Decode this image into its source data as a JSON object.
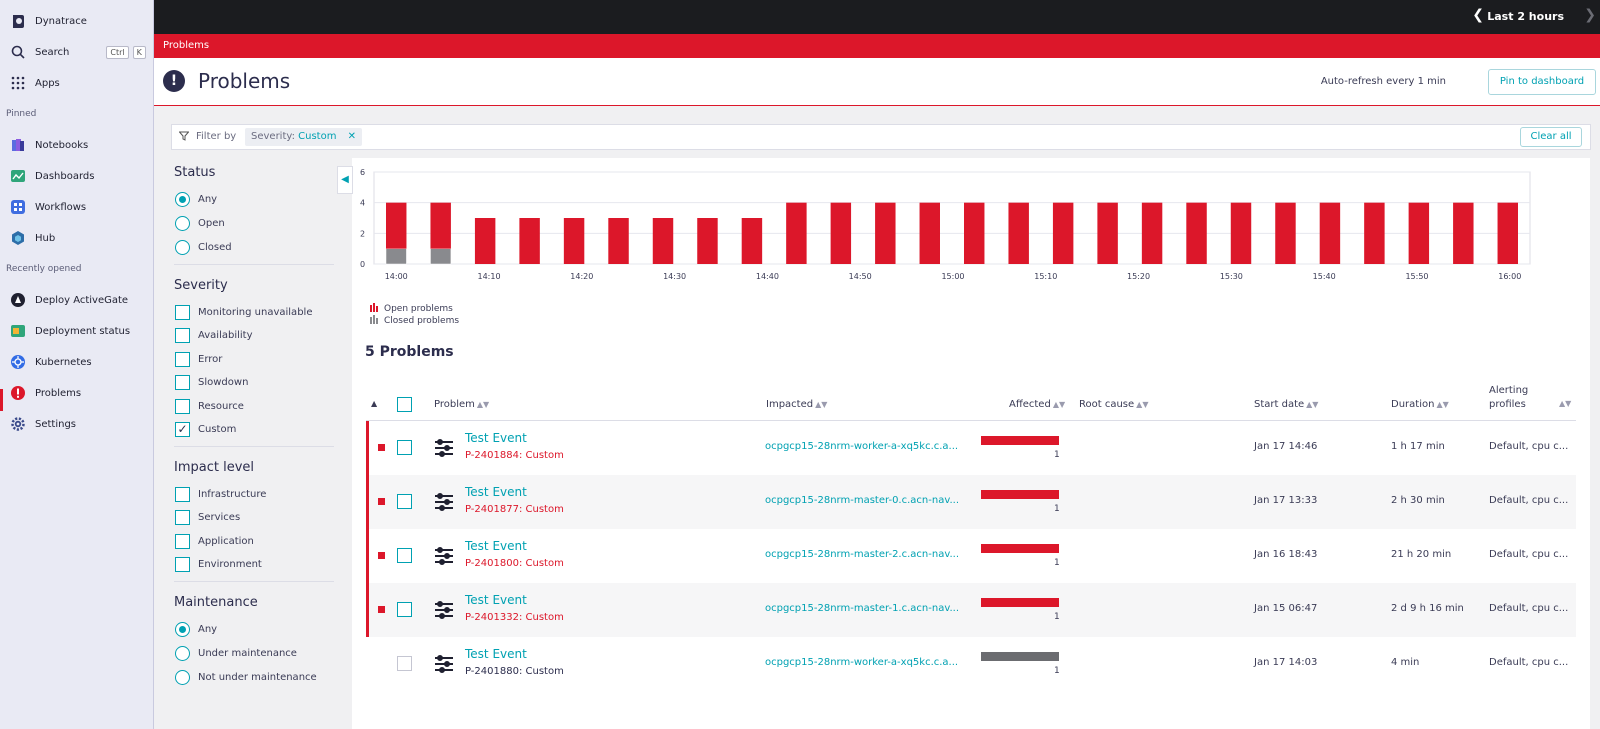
{
  "sidebar": {
    "brand": "Dynatrace",
    "search": "Search",
    "search_kbd_1": "Ctrl",
    "search_kbd_2": "K",
    "apps": "Apps",
    "pinned_label": "Pinned",
    "pinned": [
      "Notebooks",
      "Dashboards",
      "Workflows",
      "Hub"
    ],
    "recent_label": "Recently opened",
    "recent": [
      "Deploy ActiveGate",
      "Deployment status",
      "Kubernetes",
      "Problems",
      "Settings"
    ]
  },
  "topbar": {
    "timeframe": "Last 2 hours"
  },
  "app_bar": {
    "title": "Problems"
  },
  "header": {
    "title": "Problems",
    "autorefresh": "Auto-refresh every 1 min",
    "pin_button": "Pin to dashboard"
  },
  "filterbar": {
    "label": "Filter by",
    "chip_key": "Severity:",
    "chip_value": "Custom",
    "clear_button": "Clear all"
  },
  "filters": {
    "status_title": "Status",
    "status_options": [
      "Any",
      "Open",
      "Closed"
    ],
    "status_selected": "Any",
    "severity_title": "Severity",
    "severity_options": [
      "Monitoring unavailable",
      "Availability",
      "Error",
      "Slowdown",
      "Resource",
      "Custom"
    ],
    "severity_checked": [
      "Custom"
    ],
    "impact_title": "Impact level",
    "impact_options": [
      "Infrastructure",
      "Services",
      "Application",
      "Environment"
    ],
    "maintenance_title": "Maintenance",
    "maintenance_options": [
      "Any",
      "Under maintenance",
      "Not under maintenance"
    ],
    "maintenance_selected": "Any"
  },
  "chart_data": {
    "type": "bar",
    "stacked": true,
    "ylim": [
      0,
      6
    ],
    "yticks": [
      0,
      2,
      4,
      6
    ],
    "x_tick_labels": [
      "14:00",
      "14:10",
      "14:20",
      "14:30",
      "14:40",
      "14:50",
      "15:00",
      "15:10",
      "15:20",
      "15:30",
      "15:40",
      "15:50",
      "16:00"
    ],
    "series": [
      {
        "name": "Closed problems",
        "color": "#898a8e",
        "values": [
          1,
          1,
          0,
          0,
          0,
          0,
          0,
          0,
          0,
          0,
          0,
          0,
          0,
          0,
          0,
          0,
          0,
          0,
          0,
          0,
          0,
          0,
          0,
          0,
          0,
          0
        ]
      },
      {
        "name": "Open problems",
        "color": "#dc172a",
        "values": [
          3,
          3,
          3,
          3,
          3,
          3,
          3,
          3,
          3,
          4,
          4,
          4,
          4,
          4,
          4,
          4,
          4,
          4,
          4,
          4,
          4,
          4,
          4,
          4,
          4,
          4
        ]
      }
    ]
  },
  "problems": {
    "count_label": "5 Problems",
    "columns": {
      "problem": "Problem",
      "impacted": "Impacted",
      "affected": "Affected",
      "root_cause": "Root cause",
      "start_date": "Start date",
      "duration": "Duration",
      "alerting_1": "Alerting",
      "alerting_2": "profiles"
    },
    "rows": [
      {
        "name": "Test Event",
        "id": "P-2401884: Custom",
        "impacted": "ocpgcp15-28nrm-worker-a-xq5kc.c.a...",
        "affected": "1",
        "affected_level": 1,
        "start": "Jan 17 14:46",
        "duration": "1 h 17 min",
        "alerting": "Default, cpu c...",
        "open": true
      },
      {
        "name": "Test Event",
        "id": "P-2401877: Custom",
        "impacted": "ocpgcp15-28nrm-master-0.c.acn-nav...",
        "affected": "1",
        "affected_level": 1,
        "start": "Jan 17 13:33",
        "duration": "2 h 30 min",
        "alerting": "Default, cpu c...",
        "open": true
      },
      {
        "name": "Test Event",
        "id": "P-2401800: Custom",
        "impacted": "ocpgcp15-28nrm-master-2.c.acn-nav...",
        "affected": "1",
        "affected_level": 1,
        "start": "Jan 16 18:43",
        "duration": "21 h 20 min",
        "alerting": "Default, cpu c...",
        "open": true
      },
      {
        "name": "Test Event",
        "id": "P-2401332: Custom",
        "impacted": "ocpgcp15-28nrm-master-1.c.acn-nav...",
        "affected": "1",
        "affected_level": 1,
        "start": "Jan 15 06:47",
        "duration": "2 d 9 h 16 min",
        "alerting": "Default, cpu c...",
        "open": true
      },
      {
        "name": "Test Event",
        "id": "P-2401880: Custom",
        "impacted": "ocpgcp15-28nrm-worker-a-xq5kc.c.a...",
        "affected": "1",
        "affected_level": 1,
        "start": "Jan 17 14:03",
        "duration": "4 min",
        "alerting": "Default, cpu c...",
        "open": false
      }
    ]
  }
}
